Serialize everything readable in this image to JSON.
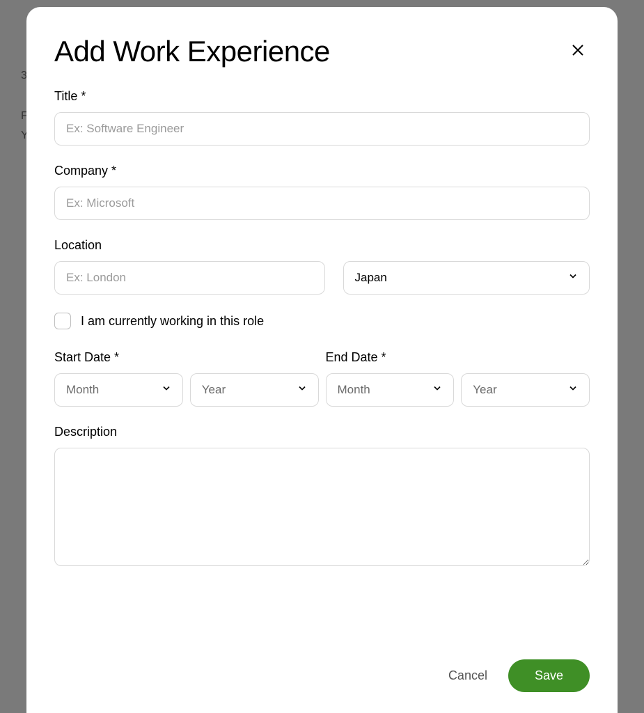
{
  "modal": {
    "title": "Add Work Experience",
    "fields": {
      "title": {
        "label": "Title *",
        "placeholder": "Ex: Software Engineer",
        "value": ""
      },
      "company": {
        "label": "Company *",
        "placeholder": "Ex: Microsoft",
        "value": ""
      },
      "location": {
        "label": "Location",
        "city_placeholder": "Ex: London",
        "city_value": "",
        "country_value": "Japan"
      },
      "currently_working": {
        "label": "I am currently working in this role",
        "checked": false
      },
      "start_date": {
        "label": "Start Date *",
        "month_placeholder": "Month",
        "year_placeholder": "Year"
      },
      "end_date": {
        "label": "End Date *",
        "month_placeholder": "Month",
        "year_placeholder": "Year"
      },
      "description": {
        "label": "Description",
        "value": ""
      }
    },
    "buttons": {
      "cancel": "Cancel",
      "save": "Save"
    }
  }
}
